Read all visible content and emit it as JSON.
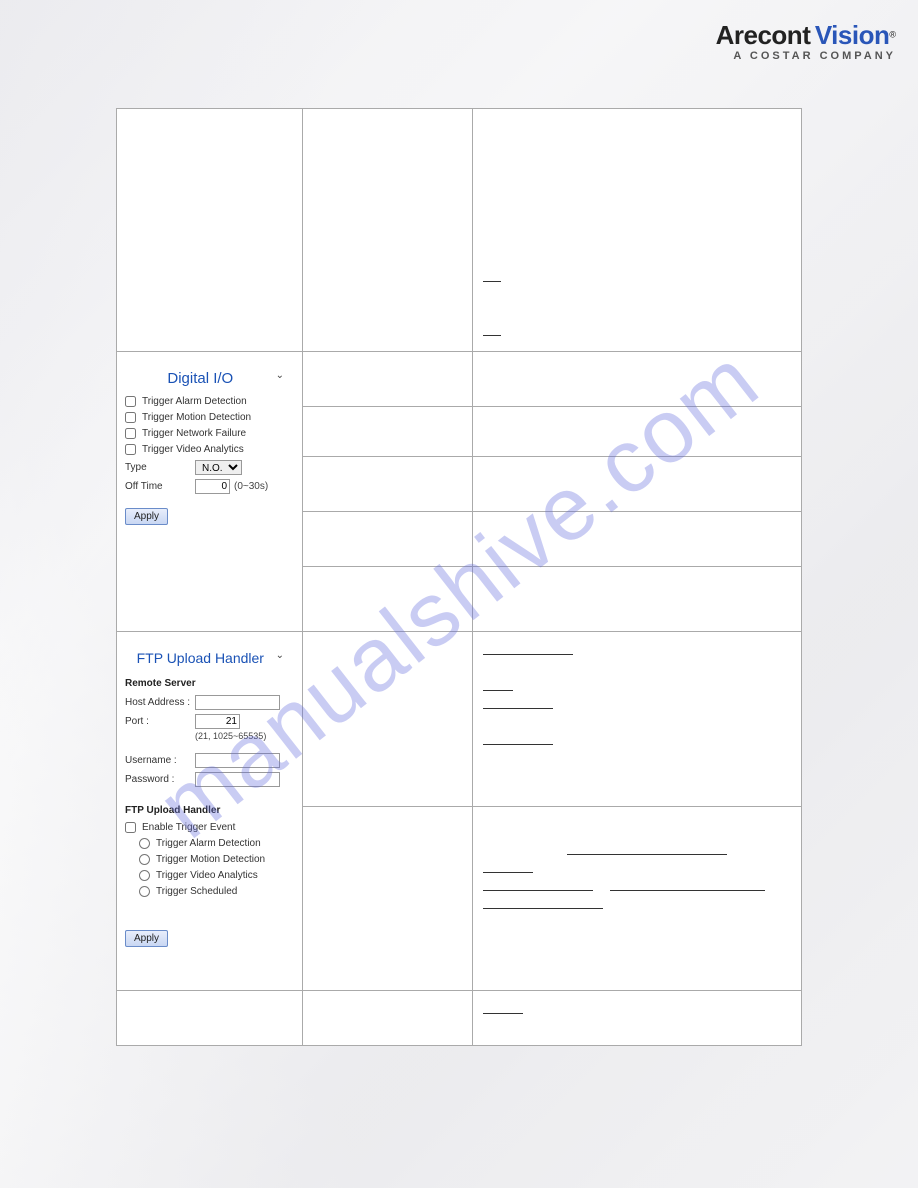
{
  "logo": {
    "arecont": "Arecont",
    "vision": "Vision",
    "reg": "®",
    "sub": "A COSTAR COMPANY"
  },
  "watermark": "manualshive.com",
  "digital_io": {
    "title": "Digital I/O",
    "trigger_alarm": "Trigger Alarm Detection",
    "trigger_motion": "Trigger Motion Detection",
    "trigger_network": "Trigger Network Failure",
    "trigger_video": "Trigger Video Analytics",
    "type_label": "Type",
    "type_value": "N.O.",
    "offtime_label": "Off Time",
    "offtime_value": "0",
    "offtime_hint": "(0~30s)",
    "apply": "Apply"
  },
  "ftp": {
    "title": "FTP Upload Handler",
    "remote_server": "Remote Server",
    "host_label": "Host Address :",
    "host_value": "",
    "port_label": "Port :",
    "port_value": "21",
    "port_hint": "(21, 1025~65535)",
    "username_label": "Username :",
    "username_value": "",
    "password_label": "Password :",
    "password_value": "",
    "handler_head": "FTP Upload Handler",
    "enable_trigger": "Enable Trigger Event",
    "r_alarm": "Trigger Alarm Detection",
    "r_motion": "Trigger Motion Detection",
    "r_video": "Trigger Video Analytics",
    "r_sched": "Trigger Scheduled",
    "apply": "Apply"
  }
}
